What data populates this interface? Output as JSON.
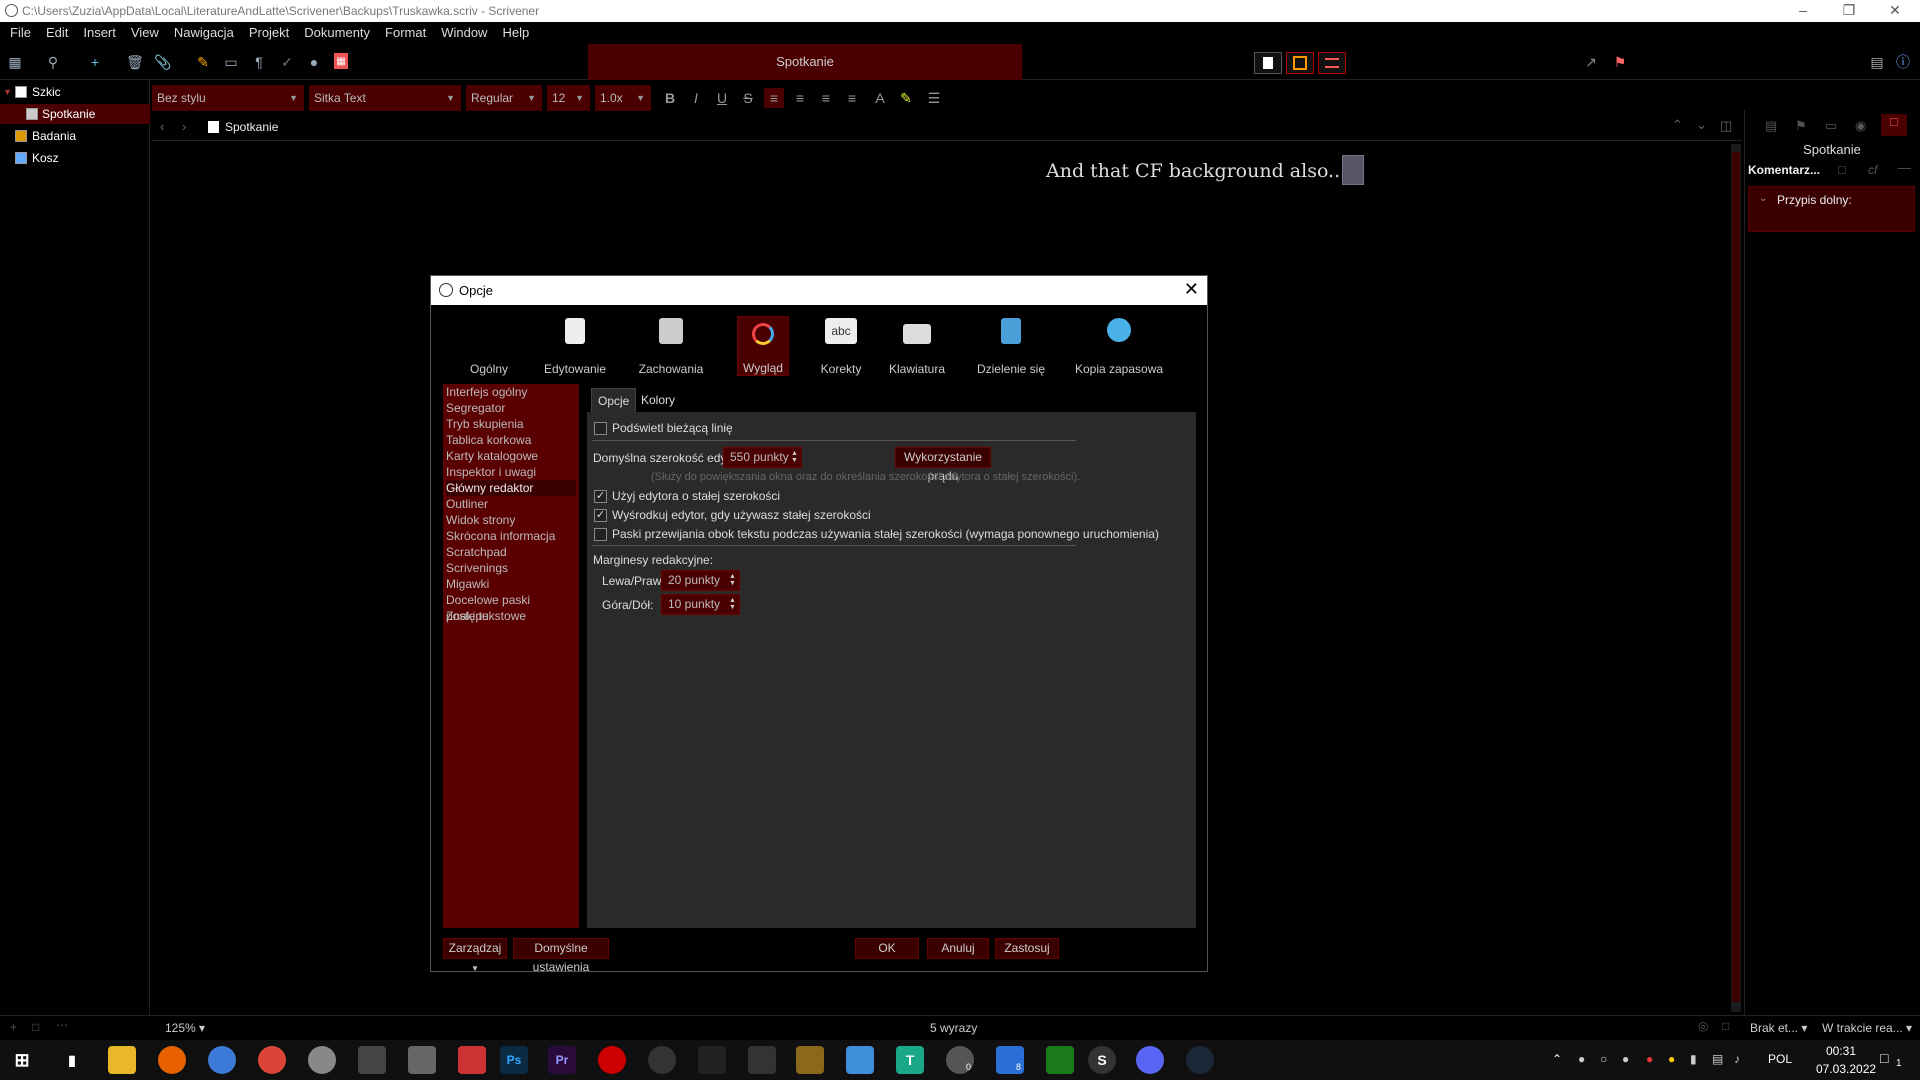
{
  "window": {
    "title_path": "C:\\Users\\Zuzia\\AppData\\Local\\LiteratureAndLatte\\Scrivener\\Backups\\Truskawka.scriv - Scrivener"
  },
  "menu": [
    "File",
    "Edit",
    "Insert",
    "View",
    "Nawigacja",
    "Projekt",
    "Dokumenty",
    "Format",
    "Window",
    "Help"
  ],
  "toolbar": {
    "document_title": "Spotkanie"
  },
  "formatbar": {
    "style": "Bez stylu",
    "font": "Sitka Text",
    "weight": "Regular",
    "size": "12",
    "spacing": "1.0x"
  },
  "binder": {
    "items": [
      "Szkic",
      "Spotkanie",
      "Badania",
      "Kosz"
    ]
  },
  "editor": {
    "header_title": "Spotkanie",
    "text": "And that CF background also..."
  },
  "inspector": {
    "title": "Spotkanie",
    "tab_comments": "Komentarz...",
    "tab_cf": "cf",
    "note_label": "Przypis dolny:"
  },
  "statusbar": {
    "zoom": "125%",
    "word_count": "5 wyrazy",
    "label_select": "Brak et...",
    "status_select": "W trakcie rea..."
  },
  "taskbar": {
    "lang": "POL",
    "time": "00:31",
    "date": "07.03.2022",
    "badge_a": "0",
    "badge_b": "8",
    "notif_count": "1"
  },
  "dialog": {
    "title": "Opcje",
    "categories": [
      "Ogólny",
      "Edytowanie",
      "Zachowania",
      "Wygląd",
      "Korekty",
      "Klawiatura",
      "Dzielenie się",
      "Kopia zapasowa"
    ],
    "category_icon_text": "abc",
    "sections": [
      "Interfejs ogólny",
      "Segregator",
      "Tryb skupienia",
      "Tablica korkowa",
      "Karty katalogowe",
      "Inspektor i uwagi",
      "Główny redaktor",
      "Outliner",
      "Widok strony",
      "Skrócona informacja",
      "Scratchpad",
      "Scrivenings",
      "Migawki",
      "Docelowe paski postępu",
      "Znaki tekstowe"
    ],
    "tabs": [
      "Opcje",
      "Kolory"
    ],
    "highlight_line": "Podświetl bieżącą linię",
    "editor_width_label": "Domyślna szerokość edytora:",
    "editor_width_value": "550 punkty",
    "use_current_button": "Wykorzystanie prądu",
    "hint": "(Służy do powiększania okna oraz do określania szerokości edytora o stałej szerokości).",
    "fixed_width": "Użyj edytora o stałej szerokości",
    "center_editor": "Wyśrodkuj edytor, gdy używasz stałej szerokości",
    "scrollbars": "Paski przewijania obok tekstu podczas używania stałej szerokości (wymaga ponownego uruchomienia)",
    "margins_title": "Marginesy redakcyjne:",
    "left_right_label": "Lewa/Prawa:",
    "left_right_value": "20 punkty",
    "top_bottom_label": "Góra/Dół:",
    "top_bottom_value": "10 punkty",
    "manage_button": "Zarządzaj",
    "defaults_button": "Domyślne ustawienia",
    "ok_button": "OK",
    "cancel_button": "Anuluj",
    "apply_button": "Zastosuj",
    "checked": {
      "highlight_line": false,
      "fixed_width": true,
      "center_editor": true,
      "scrollbars": false
    }
  },
  "colors": {
    "accent_dark_red": "#4a0000",
    "list_red": "#5a0000",
    "panel_gray": "#2a2a2a"
  }
}
